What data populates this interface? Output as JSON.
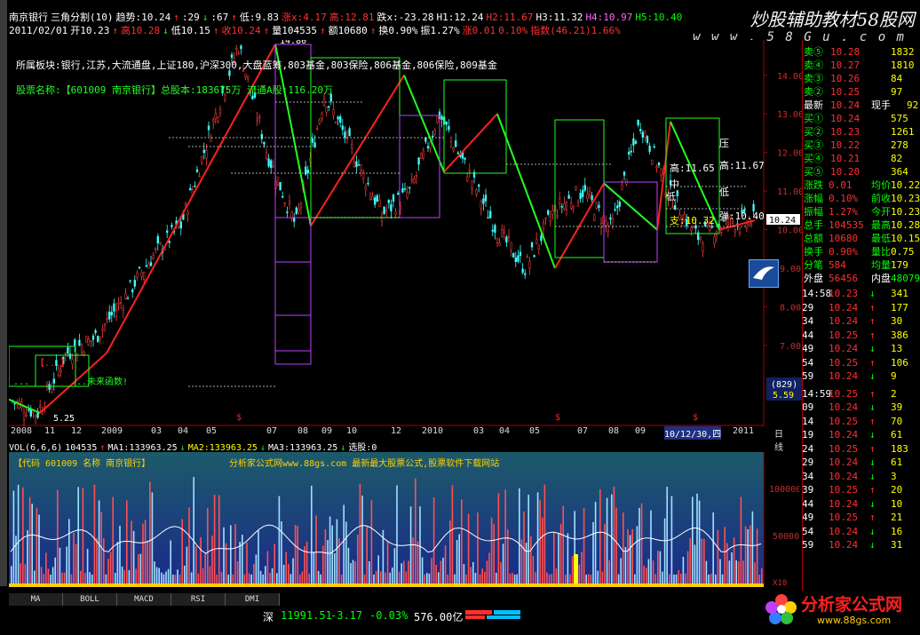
{
  "window": {
    "title": "南京银行",
    "indicator": "三角分割(10)"
  },
  "watermark": {
    "top": "炒股辅助教材58股网",
    "url": "w w w . 5 8 G u . c o m",
    "bottom_logo": "分析家公式网",
    "bottom_url": "www.88gs.com"
  },
  "header": [
    {
      "text": "南京银行",
      "color": "#ffffff"
    },
    {
      "text": "三角分割(10)",
      "color": "#ffffff"
    },
    {
      "text": "趋势:10.24",
      "color": "#ffffff"
    },
    {
      "text": "↑",
      "color": "#ff3030"
    },
    {
      "text": ":29",
      "color": "#ffffff"
    },
    {
      "text": "↓",
      "color": "#00ff00"
    },
    {
      "text": ":67",
      "color": "#ffffff"
    },
    {
      "text": "↑",
      "color": "#ff3030"
    },
    {
      "text": "低:9.83",
      "color": "#ffffff"
    },
    {
      "text": "涨x:4.17",
      "color": "#ff3030"
    },
    {
      "text": "高:12.81",
      "color": "#ff3030"
    },
    {
      "text": "跌x:-23.28",
      "color": "#ffffff"
    },
    {
      "text": "H1:12.24",
      "color": "#ffffff"
    },
    {
      "text": "H2:11.67",
      "color": "#ff3030"
    },
    {
      "text": "H3:11.32",
      "color": "#ffffff"
    },
    {
      "text": "H4:10.97",
      "color": "#ff60ff"
    },
    {
      "text": "H5:10.40",
      "color": "#00ff00"
    }
  ],
  "header2": [
    {
      "text": "2011/02/01",
      "color": "#ffffff"
    },
    {
      "text": "开10.23",
      "color": "#ffffff"
    },
    {
      "text": "↑",
      "color": "#ff3030"
    },
    {
      "text": "高10.28",
      "color": "#ff3030"
    },
    {
      "text": "↓",
      "color": "#00ff00"
    },
    {
      "text": "低10.15",
      "color": "#ffffff"
    },
    {
      "text": "↑",
      "color": "#ff3030"
    },
    {
      "text": "收10.24",
      "color": "#ff3030"
    },
    {
      "text": "↑",
      "color": "#ff3030"
    },
    {
      "text": "量104535",
      "color": "#ffffff"
    },
    {
      "text": "↑",
      "color": "#ff3030"
    },
    {
      "text": "额10680",
      "color": "#ffffff"
    },
    {
      "text": "↑",
      "color": "#ff3030"
    },
    {
      "text": "换0.90%",
      "color": "#ffffff"
    },
    {
      "text": "振1.27%",
      "color": "#ffffff"
    },
    {
      "text": "涨0.01",
      "color": "#ff3030"
    },
    {
      "text": "0.10%",
      "color": "#ff3030"
    },
    {
      "text": "指数(46.21)1.66%",
      "color": "#ff3030"
    }
  ],
  "chart_text": {
    "sector": "所属板块:银行,江苏,大流通盘,上证180,沪深300,大盘蓝筹,803基金,803保险,806基金,806保险,809基金",
    "stock_info": "股票名称:【601009 南京银行】总股本:183675万 流通A股:116.20万",
    "high_mark": "14.80",
    "low_mark": "5.25",
    "left_label1": "【...】",
    "left_label2": "...",
    "future_fn": "...未来函数!",
    "ya": "压",
    "gao_a": "高:11.65",
    "gao_b": "高:11.67",
    "zhong": "中",
    "di": "低",
    "di2": "低",
    "zhi": "支:10.32",
    "tan": "弹:10.40",
    "price_tag": "10.24",
    "count_tag": "(829)",
    "count_val": "5.59",
    "dollar": "$"
  },
  "price_axis": [
    "14.00",
    "13.00",
    "12.00",
    "11.00",
    "10.00",
    "9.00",
    "8.00",
    "7.00"
  ],
  "xaxis": [
    "2008",
    "11",
    "12",
    "2009",
    "03",
    "04",
    "05",
    "07",
    "08",
    "09",
    "10",
    "12",
    "2010",
    "03",
    "04",
    "05",
    "07",
    "08",
    "09",
    "10/12/30,四",
    "2011",
    "日线"
  ],
  "vol_header": [
    {
      "text": "VOL(6,6,6)",
      "color": "#ffffff"
    },
    {
      "text": "104535",
      "color": "#ffffff"
    },
    {
      "text": "↑",
      "color": "#ff3030"
    },
    {
      "text": "MA1:133963.25",
      "color": "#ffffff"
    },
    {
      "text": "↓",
      "color": "#00ff00"
    },
    {
      "text": "MA2:133963.25",
      "color": "#ffff00"
    },
    {
      "text": "↓",
      "color": "#00ff00"
    },
    {
      "text": "MA3:133963.25",
      "color": "#ffffff"
    },
    {
      "text": "↓",
      "color": "#00ff00"
    },
    {
      "text": "选股:0",
      "color": "#ffffff"
    }
  ],
  "vol_text": {
    "code": "【代码 601009 名称 南京银行】",
    "ad": "分析家公式网www.88gs.com 最新最大股票公式,股票软件下载网站"
  },
  "vol_axis": [
    "100000",
    "50000",
    "X10"
  ],
  "tabs": [
    "MA",
    "BOLL",
    "MACD",
    "RSI",
    "DMI"
  ],
  "status": {
    "market": "深",
    "index": "11991.51",
    "change": "-3.17",
    "pct": "-0.03%",
    "amount": "576.00亿"
  },
  "quote": {
    "asks": [
      {
        "label": "卖⑤",
        "price": "10.28",
        "vol": "1832"
      },
      {
        "label": "卖④",
        "price": "10.27",
        "vol": "1810"
      },
      {
        "label": "卖③",
        "price": "10.26",
        "vol": "84"
      },
      {
        "label": "卖②",
        "price": "10.25",
        "vol": "97"
      }
    ],
    "latest": {
      "label": "最新",
      "price": "10.24",
      "label2": "现手",
      "vol": "92"
    },
    "bids": [
      {
        "label": "买①",
        "price": "10.24",
        "vol": "575"
      },
      {
        "label": "买②",
        "price": "10.23",
        "vol": "1261"
      },
      {
        "label": "买③",
        "price": "10.22",
        "vol": "278"
      },
      {
        "label": "买④",
        "price": "10.21",
        "vol": "82"
      },
      {
        "label": "买⑤",
        "price": "10.20",
        "vol": "364"
      }
    ],
    "stats": [
      {
        "l1": "涨跌",
        "v1": "0.01",
        "l2": "均价",
        "v2": "10.22"
      },
      {
        "l1": "涨幅",
        "v1": "0.10%",
        "l2": "前收",
        "v2": "10.23"
      },
      {
        "l1": "振幅",
        "v1": "1.27%",
        "l2": "今开",
        "v2": "10.23"
      },
      {
        "l1": "总手",
        "v1": "104535",
        "l2": "最高",
        "v2": "10.28"
      },
      {
        "l1": "总额",
        "v1": "10680",
        "l2": "最低",
        "v2": "10.15"
      },
      {
        "l1": "换手",
        "v1": "0.90%",
        "l2": "量比",
        "v2": "0.75"
      },
      {
        "l1": "分笔",
        "v1": "584",
        "l2": "均量",
        "v2": "179"
      }
    ],
    "outer_inner": {
      "l1": "外盘",
      "v1": "56456",
      "l2": "内盘",
      "v2": "48079"
    },
    "ticks": [
      {
        "time": "14:58",
        "price": "10.23",
        "dir": "↓",
        "vol": "341"
      },
      {
        "time": "29",
        "price": "10.24",
        "dir": "↑",
        "vol": "177"
      },
      {
        "time": "34",
        "price": "10.24",
        "dir": "↑",
        "vol": "30"
      },
      {
        "time": "44",
        "price": "10.25",
        "dir": "↑",
        "vol": "386"
      },
      {
        "time": "49",
        "price": "10.24",
        "dir": "↓",
        "vol": "13"
      },
      {
        "time": "54",
        "price": "10.25",
        "dir": "↑",
        "vol": "106"
      },
      {
        "time": "59",
        "price": "10.24",
        "dir": "↓",
        "vol": "9"
      },
      {
        "time": "14:59",
        "price": "10.25",
        "dir": "↑",
        "vol": "2"
      },
      {
        "time": "09",
        "price": "10.24",
        "dir": "↓",
        "vol": "39"
      },
      {
        "time": "14",
        "price": "10.25",
        "dir": "↑",
        "vol": "70"
      },
      {
        "time": "19",
        "price": "10.24",
        "dir": "↓",
        "vol": "61"
      },
      {
        "time": "24",
        "price": "10.25",
        "dir": "↑",
        "vol": "183"
      },
      {
        "time": "29",
        "price": "10.24",
        "dir": "↓",
        "vol": "61"
      },
      {
        "time": "34",
        "price": "10.24",
        "dir": "↓",
        "vol": "3"
      },
      {
        "time": "39",
        "price": "10.25",
        "dir": "↑",
        "vol": "20"
      },
      {
        "time": "44",
        "price": "10.24",
        "dir": "↓",
        "vol": "10"
      },
      {
        "time": "49",
        "price": "10.25",
        "dir": "↑",
        "vol": "21"
      },
      {
        "time": "54",
        "price": "10.24",
        "dir": "↓",
        "vol": "16"
      },
      {
        "time": "59",
        "price": "10.24",
        "dir": "↓",
        "vol": "31"
      }
    ]
  },
  "chart_data": {
    "type": "line",
    "title": "",
    "series": [
      {
        "values": [
          5.6,
          5.25,
          6.8,
          7.2,
          8.2,
          9.3,
          10.1,
          12.5,
          14.8,
          12.0,
          10.1,
          13.5,
          12.0,
          10.4,
          11.0,
          13.0,
          11.5,
          10.0,
          9.0,
          10.5,
          11.0,
          10.0,
          12.8,
          11.0,
          9.8,
          10.2,
          10.24
        ]
      }
    ],
    "ylim": [
      5.0,
      15.0
    ],
    "volume": {
      "ylim": [
        0,
        130000
      ],
      "ma1": 133963.25,
      "ma2": 133963.25,
      "ma3": 133963.25,
      "last": 104535
    }
  }
}
